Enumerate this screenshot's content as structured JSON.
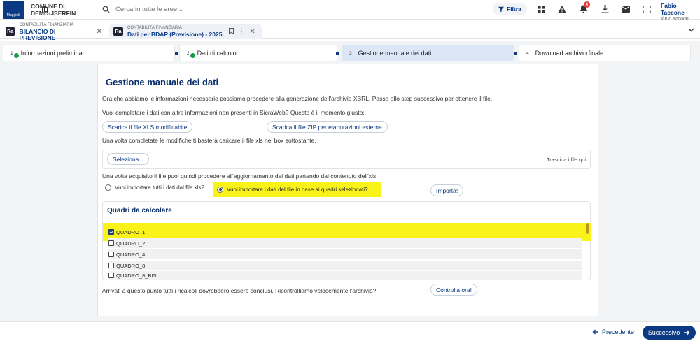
{
  "header": {
    "org_line1": "COMUNE DI",
    "org_line2": "DEMO-JSERFIN",
    "search_placeholder": "Cerca in tutte le aree...",
    "filter_label": "Filtra",
    "notifications_count": "6",
    "user_name": "Fabio Taccone",
    "user_sub": "Il tuo accoun"
  },
  "tabs": [
    {
      "small": "CONTABILITÀ FINANZIARIA",
      "big": "BILANCIO DI PREVISIONE",
      "icon": "Ra"
    },
    {
      "small": "CONTABILITÀ FINANZIARIA",
      "big": "Dati per BDAP (Previsione) - 2025",
      "icon": "Ra"
    }
  ],
  "steps": [
    {
      "num": "1",
      "label": "Informazioni preliminari",
      "done": true
    },
    {
      "num": "2",
      "label": "Dati di calcolo",
      "done": true
    },
    {
      "num": "3",
      "label": "Gestione manuale dei dati",
      "done": false
    },
    {
      "num": "4",
      "label": "Download archivio finale",
      "done": false
    }
  ],
  "main": {
    "title": "Gestione manuale dei dati",
    "intro": "Ora che abbiamo le informazioni necessarie possiamo procedere alla generazione dell'archivio XBRL. Passa allo step successivo per ottenere il file.",
    "question": "Vuoi completare i dati con altre informazioni non presenti in SicraWeb? Questo è il momento giusto:",
    "btn_xls": "Scarica il file XLS modificabile",
    "btn_zip": "Scarica il file ZIP per elaborazioni esterne",
    "upload_text": "Una volta completate le modifiche ti basterà caricare il file xls nel box sottostante.",
    "select_btn": "Seleziona...",
    "drop_hint": "Trascina i file qui",
    "import_text": "Una volta acquisito il file puoi quindi procedere all'aggiornamento dei dati partendo dal contenuto dell'xls:",
    "radio_all": "Vuoi importare tutti i dati dal file xls?",
    "radio_selected": "Vuoi importare i dati del file in base ai quadri selezionati?",
    "import_btn": "Importa!",
    "quadri_title": "Quadri da calcolare",
    "quadri": [
      {
        "label": "QUADRO_1",
        "checked": true
      },
      {
        "label": "QUADRO_2",
        "checked": false
      },
      {
        "label": "QUADRO_4",
        "checked": false
      },
      {
        "label": "QUADRO_8",
        "checked": false
      },
      {
        "label": "QUADRO_8_BIS",
        "checked": false
      }
    ],
    "final_text": "Arrivati a questo punto tutti i ricalcoli dovrebbero essere conclusi. Ricontrolliamo velocemente l'archivio?",
    "check_btn": "Controlla ora!"
  },
  "footer": {
    "prev_label": "Precedente",
    "next_label": "Successivo"
  }
}
